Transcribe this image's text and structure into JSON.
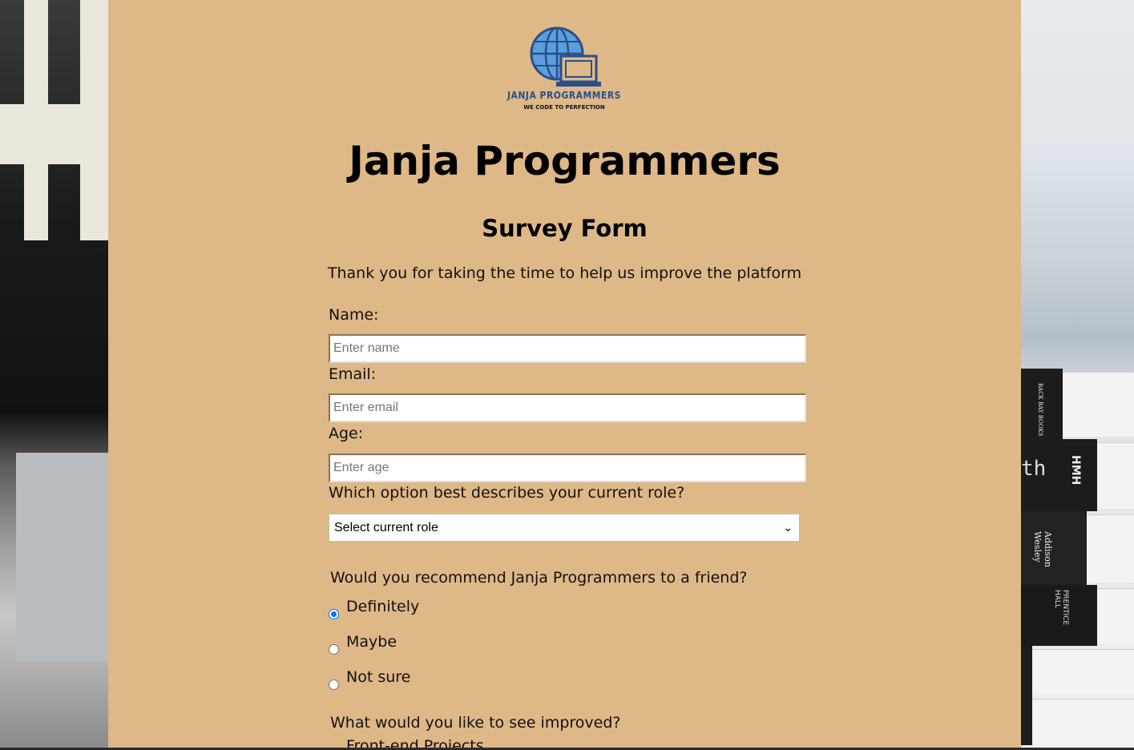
{
  "logo": {
    "name": "JANJA PROGRAMMERS",
    "tagline": "WE CODE TO PERFECTION"
  },
  "header": {
    "title": "Janja Programmers",
    "subtitle": "Survey Form",
    "description": "Thank you for taking the time to help us improve the platform"
  },
  "form": {
    "name": {
      "label": "Name:",
      "placeholder": "Enter name"
    },
    "email": {
      "label": "Email:",
      "placeholder": "Enter email"
    },
    "age": {
      "label": "Age:",
      "placeholder": "Enter age"
    },
    "role": {
      "label": "Which option best describes your current role?",
      "selected": "Select current role"
    },
    "recommend": {
      "question": "Would you recommend Janja Programmers to a friend?",
      "options": [
        "Definitely",
        "Maybe",
        "Not sure"
      ],
      "selected": "Definitely"
    },
    "improve": {
      "question": "What would you like to see improved?",
      "first_option": "Front-end Projects"
    }
  },
  "background_books": {
    "spines": [
      "BACK BAY BOOKS",
      "th",
      "HMH",
      "Addison Wesley",
      "PRENTICE HALL"
    ]
  }
}
